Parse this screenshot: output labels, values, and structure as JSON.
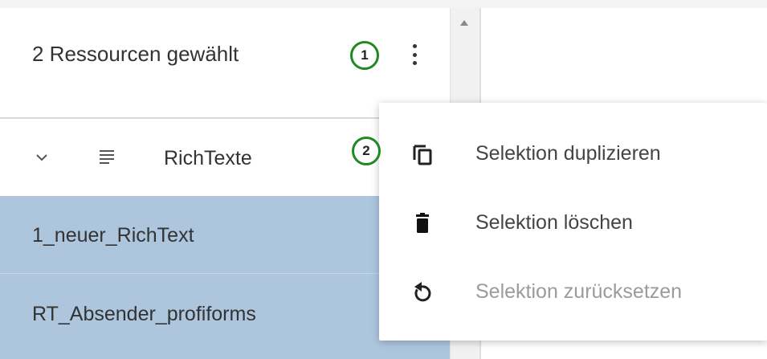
{
  "header": {
    "title": "2 Ressourcen gewählt",
    "callout_1": "1",
    "more_icon": "more-vert-icon"
  },
  "tree": {
    "group_label": "RichTexte",
    "group_icon": "lines-icon",
    "expand_icon": "chevron-down-icon",
    "selected_items": [
      {
        "label": "1_neuer_RichText"
      },
      {
        "label": "RT_Absender_profiforms"
      }
    ]
  },
  "menu": {
    "callout_2": "2",
    "items": [
      {
        "label": "Selektion duplizieren",
        "icon": "copy-icon",
        "enabled": true
      },
      {
        "label": "Selektion löschen",
        "icon": "trash-icon",
        "enabled": true
      },
      {
        "label": "Selektion zurücksetzen",
        "icon": "reset-icon",
        "enabled": false
      }
    ]
  },
  "colors": {
    "selection": "#adc6de",
    "callout_border": "#1f8a1f"
  }
}
